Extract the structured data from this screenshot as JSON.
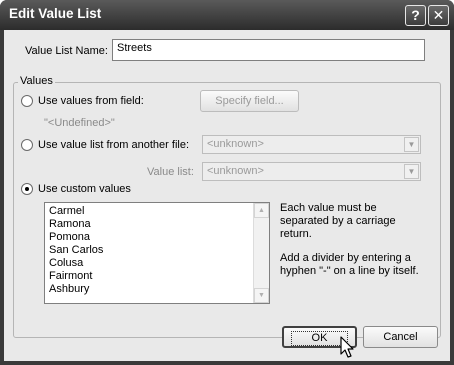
{
  "window": {
    "title": "Edit Value List",
    "help_glyph": "?",
    "close_glyph": "✕"
  },
  "name_field": {
    "label": "Value List Name:",
    "value": "Streets"
  },
  "values_group": {
    "title": "Values",
    "use_field": {
      "label": "Use values from field:",
      "button": "Specify field...",
      "undefined_text": "\"<Undefined>\""
    },
    "use_other_file": {
      "label": "Use value list from another file:",
      "file_select": "<unknown>",
      "value_list_label": "Value list:",
      "value_list_select": "<unknown>"
    },
    "use_custom": {
      "label": "Use custom values",
      "items": [
        "Carmel",
        "Ramona",
        "Pomona",
        "San Carlos",
        "Colusa",
        "Fairmont",
        "Ashbury"
      ]
    },
    "hint_line_1": "Each value must be",
    "hint_line_2": "separated by a carriage",
    "hint_line_3": "return.",
    "hint_line_4": "Add a divider by entering a",
    "hint_line_5": "hyphen \"-\" on a line by itself."
  },
  "buttons": {
    "ok": "OK",
    "cancel": "Cancel"
  }
}
